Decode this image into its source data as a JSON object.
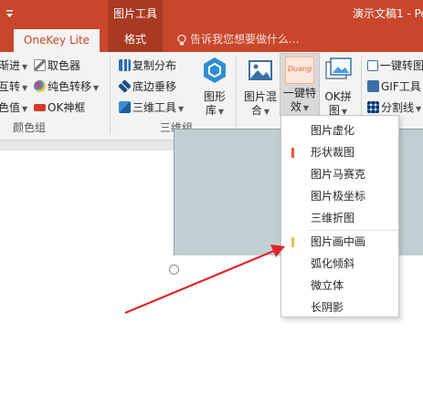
{
  "titlebar": {
    "context_label": "图片工具",
    "doc_title": "演示文稿1 - Po"
  },
  "tabs": {
    "onekey": "OneKey Lite",
    "format": "格式",
    "tell_me": "告诉我您想要做什么..."
  },
  "ribbon": {
    "color_group": {
      "label": "颜色组",
      "items": [
        "渐进",
        "取色器",
        "互转",
        "纯色转移",
        "色值",
        "OK神框"
      ]
    },
    "three_d_group": {
      "label": "三维组",
      "items": [
        "复制分布",
        "底边垂移",
        "三维工具"
      ]
    },
    "big_buttons": {
      "shape_lib": [
        "图形",
        "库"
      ],
      "pic_mix": [
        "图片混",
        "合"
      ],
      "one_click": [
        "一键特",
        "效"
      ],
      "one_click_preview": "Duang",
      "ok_puzzle": [
        "OK拼",
        "图"
      ]
    },
    "right_items": [
      "一键转图",
      "GIF工具",
      "分割线"
    ]
  },
  "menu": {
    "items": [
      "图片虚化",
      "形状裁图",
      "图片马赛克",
      "图片极坐标",
      "三维折图",
      "图片画中画",
      "弧化倾斜",
      "微立体",
      "长阴影"
    ],
    "colors": {
      "red": "#e05a3c",
      "orange": "#f5b85a"
    }
  },
  "colors": {
    "accent": "#c8462b",
    "accent_dark": "#a83a22",
    "arrow": "#e0252b"
  }
}
